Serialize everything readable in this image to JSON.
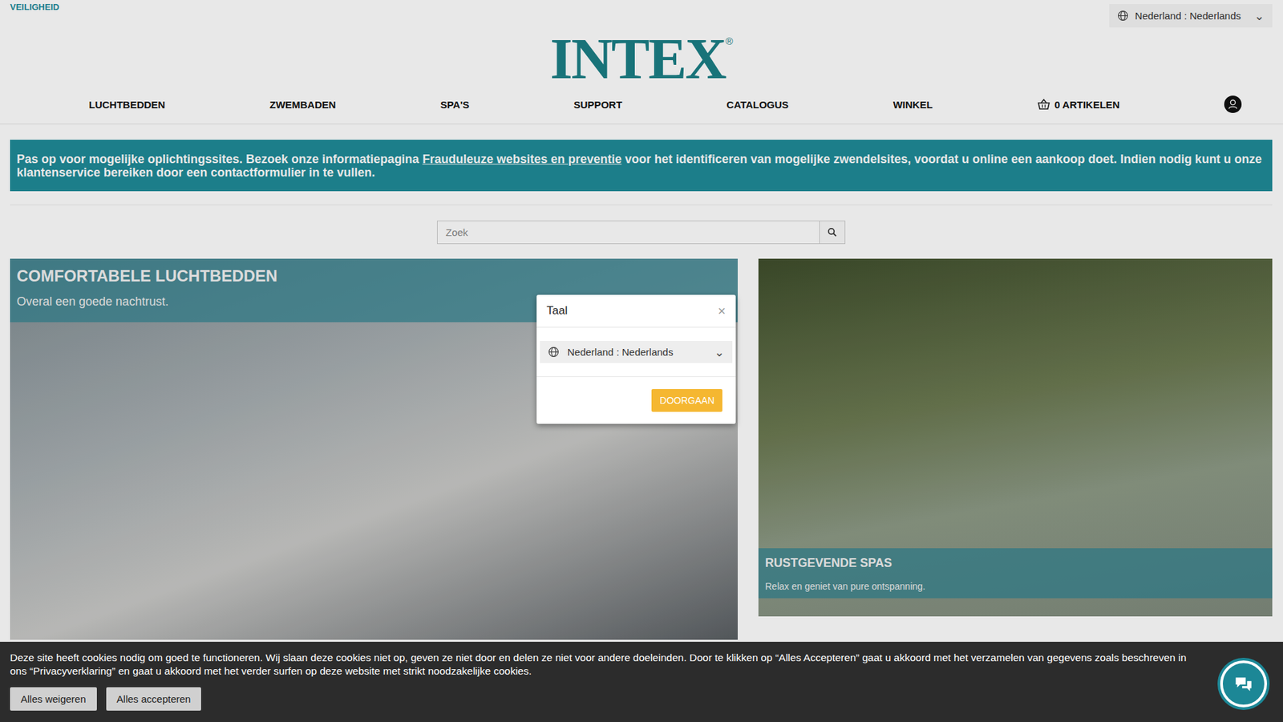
{
  "top_bar": {
    "link": "VEILIGHEID",
    "language": "Nederland : Nederlands",
    "chevron": "⌄"
  },
  "logo": {
    "text": "INTEX",
    "mark": "®"
  },
  "nav": {
    "items": [
      "LUCHTBEDDEN",
      "ZWEMBADEN",
      "SPA'S",
      "SUPPORT",
      "CATALOGUS",
      "WINKEL"
    ],
    "cart": "0 ARTIKELEN"
  },
  "banner": {
    "before": "Pas op voor mogelijke oplichtingssites. Bezoek onze informatiepagina ",
    "link": "Frauduleuze websites en preventie",
    "after": " voor het identificeren van mogelijke zwendelsites, voordat u online een aankoop doet. Indien nodig kunt u onze klantenservice bereiken door een contactformulier in te vullen."
  },
  "search": {
    "placeholder": "Zoek"
  },
  "cards": [
    {
      "title": "COMFORTABELE LUCHTBEDDEN",
      "subtitle": "Overal een goede nachtrust.",
      "kind": "caption-top"
    },
    {
      "title": "RUSTGEVENDE SPAS",
      "subtitle": "Relax en geniet van pure ontspanning.",
      "kind": "caption-bottom"
    }
  ],
  "modal": {
    "title": "Taal",
    "close": "×",
    "language": "Nederland : Nederlands",
    "button": "DOORGAAN"
  },
  "cookie_bar": {
    "text": "Deze site heeft cookies nodig om goed te functioneren. Wij slaan deze cookies niet op, geven ze niet door en delen ze niet voor andere doeleinden. Door te klikken op “Alles Accepteren” gaat u akkoord met het verzamelen van gegevens zoals beschreven in ons “Privacyverklaring” en gaat u akkoord met het verder surfen op deze website met strikt noodzakelijke cookies.",
    "buttons": [
      "Alles weigeren",
      "Alles accepteren"
    ]
  }
}
